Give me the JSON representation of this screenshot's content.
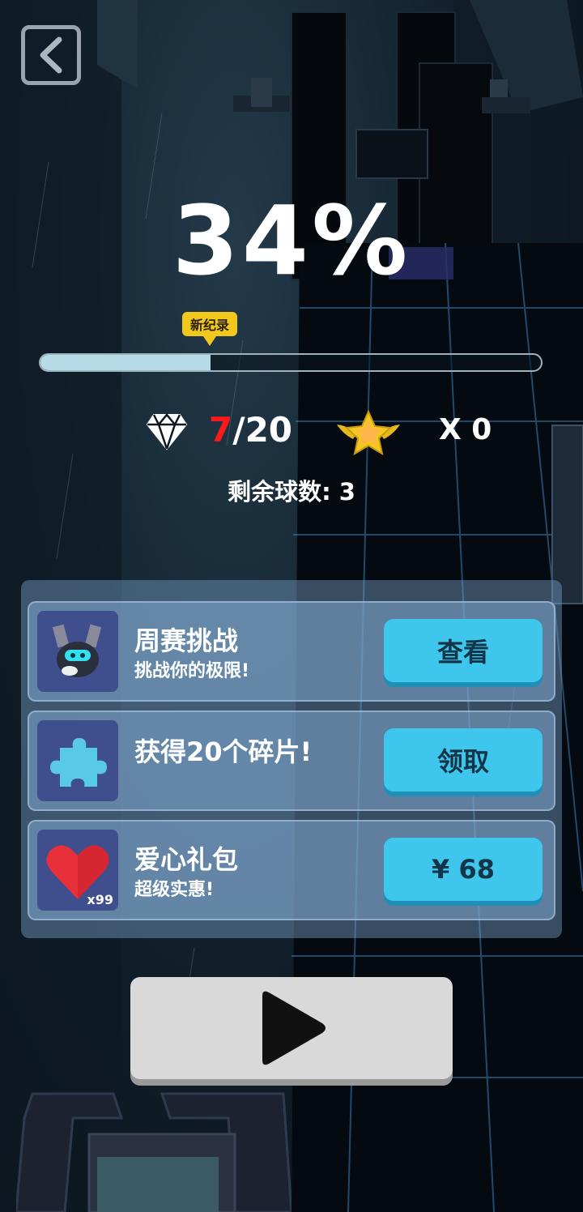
{
  "hud": {
    "percent": "34%",
    "record_badge": "新纪录",
    "progress": 0.34,
    "gems_current": "7",
    "gems_total": "/20",
    "stars": "X 0",
    "balls_left": "剩余球数: 3"
  },
  "offers": [
    {
      "title": "周赛挑战",
      "subtitle": "挑战你的极限!",
      "button": "查看",
      "icon": "robot-icon"
    },
    {
      "title": "获得20个碎片!",
      "subtitle": "",
      "button": "领取",
      "icon": "puzzle-icon"
    },
    {
      "title": "爱心礼包",
      "subtitle": "超级实惠!",
      "button": "¥ 68",
      "icon": "heart-icon",
      "badge": "x99"
    }
  ],
  "colors": {
    "accent_button": "#3ec6ec",
    "gem_current": "#ff1a1a",
    "record_badge": "#f2c81d",
    "progress_fill": "#b6dbe6"
  }
}
